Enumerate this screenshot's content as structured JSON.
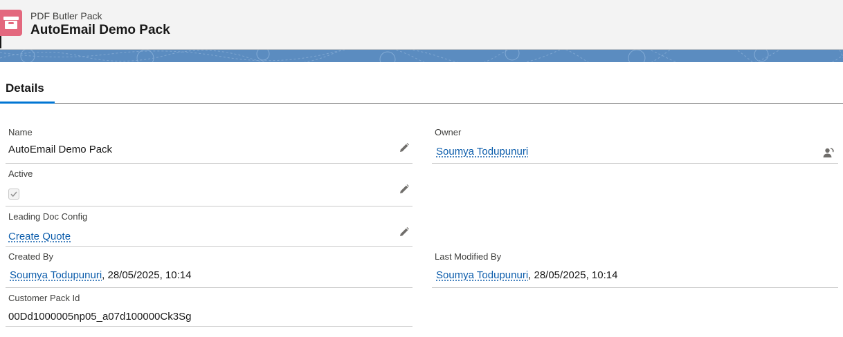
{
  "header": {
    "object_type": "PDF Butler Pack",
    "record_title": "AutoEmail Demo Pack",
    "icon": "archive-box-icon",
    "icon_color": "#e3687e"
  },
  "banner": {
    "color": "#5b8cc0"
  },
  "tabs": [
    {
      "label": "Details",
      "active": true
    }
  ],
  "fields": {
    "name": {
      "label": "Name",
      "value": "AutoEmail Demo Pack"
    },
    "owner": {
      "label": "Owner",
      "value": "Soumya Todupunuri",
      "action_icon": "change-owner-icon"
    },
    "active": {
      "label": "Active",
      "checked": true
    },
    "leading_doc_config": {
      "label": "Leading Doc Config",
      "value": "Create Quote"
    },
    "created_by": {
      "label": "Created By",
      "user": "Soumya Todupunuri",
      "suffix": ", 28/05/2025, 10:14"
    },
    "last_modified_by": {
      "label": "Last Modified By",
      "user": "Soumya Todupunuri",
      "suffix": ", 28/05/2025, 10:14"
    },
    "customer_pack_id": {
      "label": "Customer Pack Id",
      "value": "00Dd1000005np05_a07d100000Ck3Sg"
    }
  },
  "colors": {
    "link": "#0b5cab",
    "tab_accent": "#0176d3"
  }
}
